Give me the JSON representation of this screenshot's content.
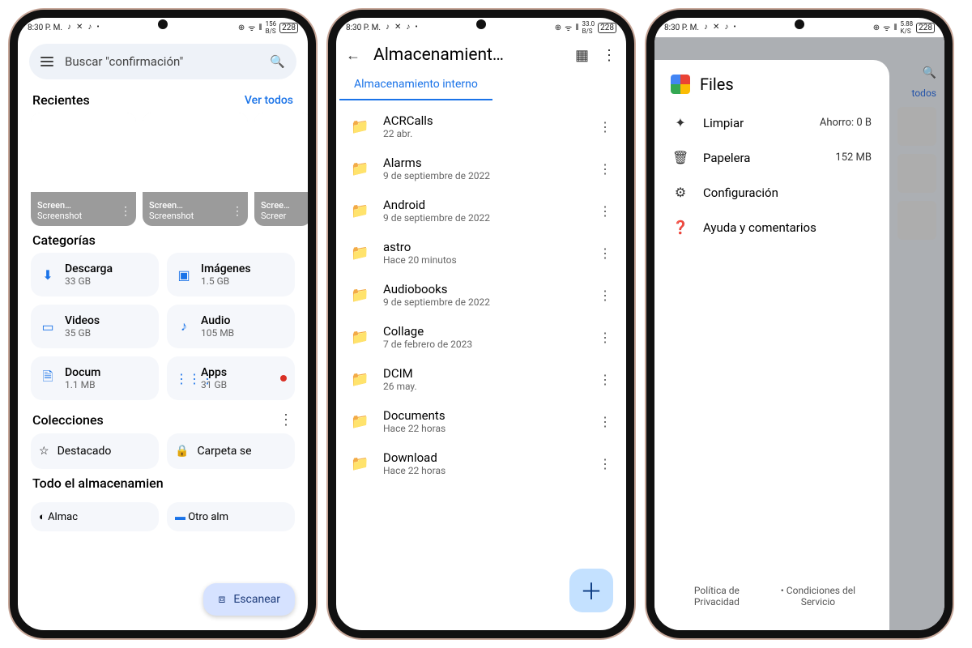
{
  "status": {
    "time": "8:30 P. M.",
    "icons_left": [
      "♪",
      "✕",
      "♪",
      "•"
    ],
    "icons_right": [
      "⊕",
      "ᯤ",
      "⫴",
      "156 B/S",
      "228"
    ],
    "icons_right_3": [
      "⊕",
      "ᯤ",
      "⫴",
      "5.88 K/S",
      "228"
    ]
  },
  "phone1": {
    "search_placeholder": "Buscar \"confirmación\"",
    "recents_title": "Recientes",
    "recents_link": "Ver todos",
    "recents": [
      {
        "title": "Screen…",
        "sub": "Screenshot"
      },
      {
        "title": "Screen…",
        "sub": "Screenshot"
      },
      {
        "title": "Scree…",
        "sub": "Screer"
      }
    ],
    "categories_title": "Categorías",
    "categories": [
      {
        "icon": "⬇",
        "label": "Descarga",
        "sub": "33 GB"
      },
      {
        "icon": "▣",
        "label": "Imágenes",
        "sub": "1.5 GB"
      },
      {
        "icon": "▭",
        "label": "Videos",
        "sub": "35 GB"
      },
      {
        "icon": "♪",
        "label": "Audio",
        "sub": "105 MB"
      },
      {
        "icon": "🗎",
        "label": "Docum",
        "sub": "1.1 MB"
      },
      {
        "icon": "⋮⋮⋮",
        "label": "Apps",
        "sub": "31 GB",
        "dot": true
      }
    ],
    "collections_title": "Colecciones",
    "collections": [
      {
        "icon": "☆",
        "label": "Destacado"
      },
      {
        "icon": "🔒",
        "label": "Carpeta se"
      }
    ],
    "storage_title": "Todo el almacenamien",
    "storage_items": [
      {
        "label": "Almac"
      },
      {
        "label": "Otro alm"
      }
    ],
    "fab": "Escanear"
  },
  "phone2": {
    "title": "Almacenamient…",
    "tab": "Almacenamiento interno",
    "folders": [
      {
        "name": "ACRCalls",
        "sub": "22 abr."
      },
      {
        "name": "Alarms",
        "sub": "9 de septiembre de 2022"
      },
      {
        "name": "Android",
        "sub": "9 de septiembre de 2022"
      },
      {
        "name": "astro",
        "sub": "Hace 20 minutos"
      },
      {
        "name": "Audiobooks",
        "sub": "9 de septiembre de 2022"
      },
      {
        "name": "Collage",
        "sub": "7 de febrero de 2023"
      },
      {
        "name": "DCIM",
        "sub": "26 may."
      },
      {
        "name": "Documents",
        "sub": "Hace 22 horas"
      },
      {
        "name": "Download",
        "sub": "Hace 22 horas"
      }
    ]
  },
  "phone3": {
    "app_name": "Files",
    "items": [
      {
        "icon": "✦",
        "label": "Limpiar",
        "value": "Ahorro: 0 B"
      },
      {
        "icon": "🗑",
        "label": "Papelera",
        "value": "152 MB"
      },
      {
        "icon": "⚙",
        "label": "Configuración",
        "value": ""
      },
      {
        "icon": "❓",
        "label": "Ayuda y comentarios",
        "value": ""
      }
    ],
    "footer": {
      "privacy": "Política de Privacidad",
      "tos": "• Condiciones del Servicio"
    },
    "right_link": "todos"
  }
}
